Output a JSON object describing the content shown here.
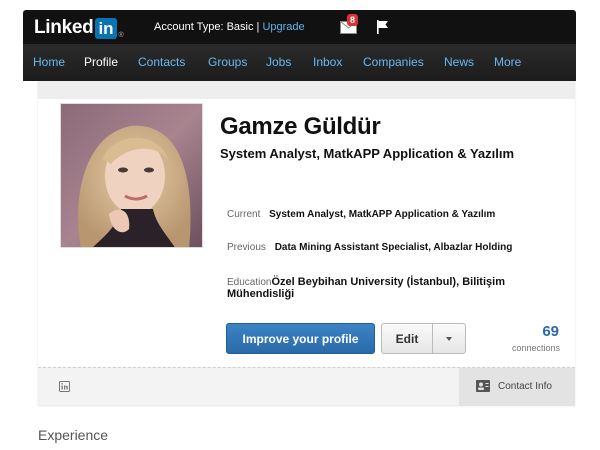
{
  "topbar": {
    "logo_text": "Linked",
    "logo_in": "in",
    "logo_reg": "®",
    "account_prefix": "Account Type: Basic | ",
    "upgrade_label": "Upgrade",
    "mail_count": "8",
    "mail_icon": "mail-icon",
    "flag_icon": "flag-icon"
  },
  "nav": {
    "items": [
      {
        "label": "Home",
        "active": false
      },
      {
        "label": "Profile",
        "active": true
      },
      {
        "label": "Contacts",
        "active": false
      },
      {
        "label": "Groups",
        "active": false
      },
      {
        "label": "Jobs",
        "active": false
      },
      {
        "label": "Inbox",
        "active": false
      },
      {
        "label": "Companies",
        "active": false
      },
      {
        "label": "News",
        "active": false
      },
      {
        "label": "More",
        "active": false
      }
    ]
  },
  "profile": {
    "name": "Gamze Güldür",
    "headline": "System Analyst, MatkAPP Application & Yazılım",
    "current_label": "Current",
    "current_value": "System Analyst, MatkAPP Application & Yazılım",
    "previous_label": "Previous",
    "previous_value": "Data Mining Assistant Specialist, Albazlar Holding",
    "education_label": "Education",
    "education_value": "Özel Beybihan University (İstanbul), Bilitişim Mühendisliği",
    "improve_label": "Improve your profile",
    "edit_label": "Edit",
    "connections_count": "69",
    "connections_label": "connections",
    "contact_info_label": "Contact Info"
  },
  "section": {
    "experience_title": "Experience"
  },
  "colors": {
    "topbar_bg": "#111111",
    "nav_link": "#69b8f1",
    "brand_blue": "#0a73b1",
    "button_blue": "#2b6aa8",
    "badge_red": "#d93434"
  }
}
